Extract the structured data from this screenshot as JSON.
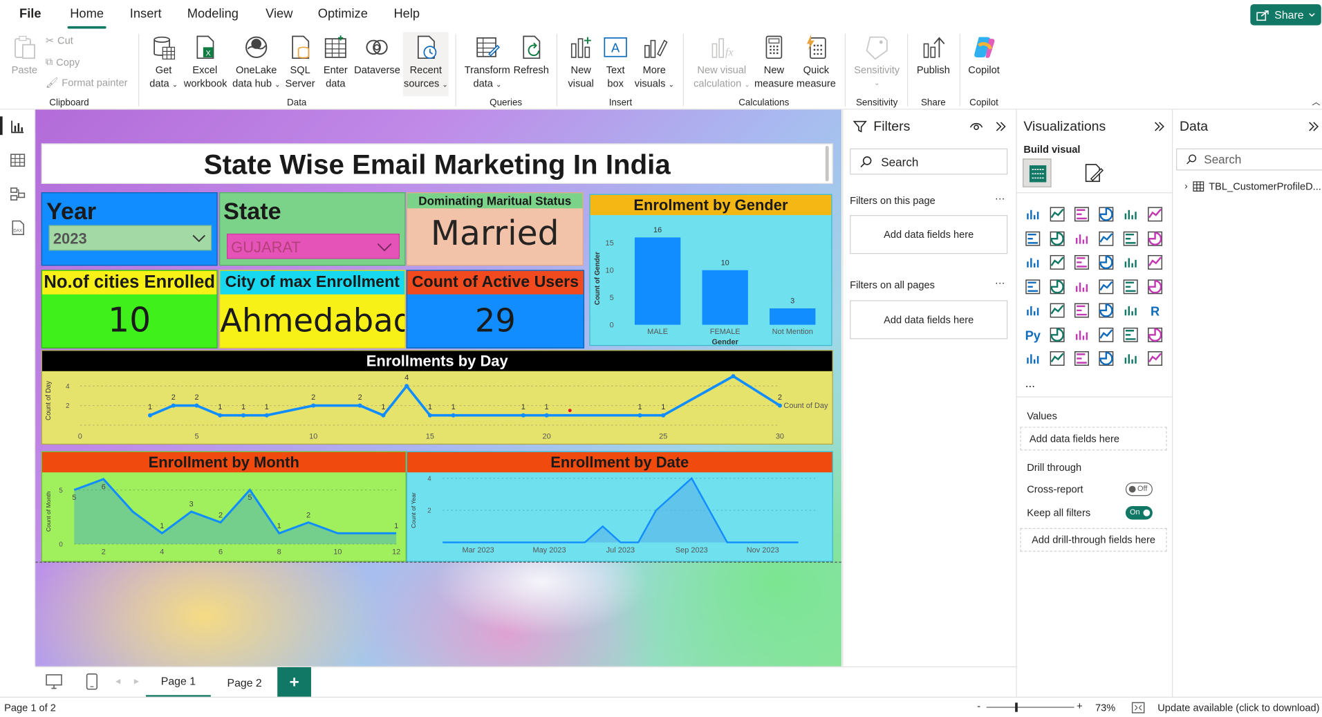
{
  "menu": {
    "items": [
      "File",
      "Home",
      "Insert",
      "Modeling",
      "View",
      "Optimize",
      "Help"
    ],
    "share_label": "Share"
  },
  "ribbon": {
    "clipboard": {
      "paste": "Paste",
      "cut": "Cut",
      "copy": "Copy",
      "format_painter": "Format painter",
      "group": "Clipboard"
    },
    "data": {
      "get_data": [
        "Get",
        "data"
      ],
      "excel": [
        "Excel",
        "workbook"
      ],
      "onelake": [
        "OneLake",
        "data hub"
      ],
      "sql": [
        "SQL",
        "Server"
      ],
      "enter": [
        "Enter",
        "data"
      ],
      "dataverse": [
        "Dataverse"
      ],
      "recent": [
        "Recent",
        "sources"
      ],
      "group": "Data"
    },
    "queries": {
      "transform": [
        "Transform",
        "data"
      ],
      "refresh": [
        "Refresh"
      ],
      "group": "Queries"
    },
    "insert": {
      "new_visual": [
        "New",
        "visual"
      ],
      "text_box": [
        "Text",
        "box"
      ],
      "more_visuals": [
        "More",
        "visuals"
      ],
      "group": "Insert"
    },
    "calculations": {
      "new_visual_calc": [
        "New visual",
        "calculation"
      ],
      "new_measure": [
        "New",
        "measure"
      ],
      "quick_measure": [
        "Quick",
        "measure"
      ],
      "group": "Calculations"
    },
    "sensitivity": {
      "label": "Sensitivity",
      "group": "Sensitivity"
    },
    "share": {
      "publish": "Publish",
      "group": "Share"
    },
    "copilot": {
      "label": "Copilot",
      "group": "Copilot"
    }
  },
  "report": {
    "title": "State Wise Email Marketing In India",
    "year": {
      "label": "Year",
      "value": "2023"
    },
    "state": {
      "label": "State",
      "value": "GUJARAT"
    },
    "marital": {
      "label": "Dominating Maritual Status",
      "value": "Married"
    },
    "cities": {
      "label": "No.of cities Enrolled",
      "value": "10"
    },
    "max_city": {
      "label": "City of max Enrollment",
      "value": "Ahmedabad"
    },
    "active": {
      "label": "Count of Active Users",
      "value": "29"
    },
    "gender_title": "Enrolment by Gender",
    "day_title": "Enrollments by Day",
    "month_title": "Enrollment by Month",
    "date_title": "Enrollment by Date"
  },
  "chart_data": [
    {
      "type": "bar",
      "title": "Enrolment by Gender",
      "xlabel": "Gender",
      "ylabel": "Count of Gender",
      "categories": [
        "MALE",
        "FEMALE",
        "Not Mention"
      ],
      "values": [
        16,
        10,
        3
      ],
      "yticks": [
        0,
        5,
        10,
        15
      ],
      "ylim": [
        0,
        17
      ],
      "color": "#118dff"
    },
    {
      "type": "line",
      "title": "Enrollments by Day",
      "ylabel": "Count of Day",
      "legend": "Count of Day",
      "x": [
        3,
        4,
        5,
        6,
        7,
        8,
        10,
        12,
        13,
        14,
        15,
        16,
        19,
        20,
        24,
        25,
        28,
        30
      ],
      "y": [
        1,
        2,
        2,
        1,
        1,
        1,
        2,
        2,
        1,
        4,
        1,
        1,
        1,
        1,
        1,
        1,
        5,
        2
      ],
      "xticks": [
        0,
        5,
        10,
        15,
        20,
        25,
        30
      ],
      "yticks": [
        2,
        4
      ],
      "xlim": [
        0,
        30
      ],
      "ylim": [
        0,
        5
      ],
      "highlight_point": {
        "x": 21,
        "y": 1.5
      },
      "color": "#118dff"
    },
    {
      "type": "area",
      "title": "Enrollment by Month",
      "ylabel": "Count of Month",
      "x": [
        1,
        2,
        3,
        4,
        5,
        6,
        7,
        8,
        9,
        10,
        11,
        12
      ],
      "y": [
        5,
        6,
        3,
        1,
        3,
        2,
        5,
        1,
        2,
        1,
        1,
        1
      ],
      "point_labels": [
        "5",
        "6",
        "",
        "1",
        "3",
        "2",
        "5",
        "1",
        "2",
        "",
        "",
        "1"
      ],
      "xticks": [
        2,
        4,
        6,
        8,
        10,
        12
      ],
      "yticks": [
        0,
        5
      ],
      "xlim": [
        1,
        12
      ],
      "ylim": [
        0,
        6
      ],
      "color": "#118dff"
    },
    {
      "type": "area",
      "title": "Enrollment by Date",
      "ylabel": "Count of Year",
      "x": [
        "Feb 2023",
        "Mar 2023",
        "Apr 2023",
        "May 2023",
        "Jun 2023",
        "Jun 2023",
        "Jul 2023",
        "Jul 2023",
        "Aug 2023",
        "Aug 2023",
        "Sep 2023",
        "Oct 2023",
        "Nov 2023",
        "Dec 2023"
      ],
      "y": [
        0,
        0,
        0,
        0,
        0,
        1,
        0,
        0,
        2,
        3,
        4,
        0,
        0,
        0
      ],
      "xticks": [
        "Mar 2023",
        "May 2023",
        "Jul 2023",
        "Sep 2023",
        "Nov 2023"
      ],
      "yticks": [
        2,
        4
      ],
      "ylim": [
        0,
        4
      ],
      "color": "#118dff"
    }
  ],
  "filters": {
    "title": "Filters",
    "search_placeholder": "Search",
    "on_this_page": "Filters on this page",
    "on_all_pages": "Filters on all pages",
    "add_fields": "Add data fields here"
  },
  "visualizations": {
    "title": "Visualizations",
    "build_visual": "Build visual",
    "values": "Values",
    "add_values": "Add data fields here",
    "drill_through": "Drill through",
    "cross_report": "Cross-report",
    "cross_report_state": "Off",
    "keep_filters": "Keep all filters",
    "keep_filters_state": "On",
    "add_drill": "Add drill-through fields here",
    "more": "..."
  },
  "data_pane": {
    "title": "Data",
    "search_placeholder": "Search",
    "table": "TBL_CustomerProfileD..."
  },
  "pages": {
    "tabs": [
      "Page 1",
      "Page 2"
    ],
    "active": "Page 1",
    "add": "+"
  },
  "status": {
    "page_info": "Page 1 of 2",
    "zoom": "73%",
    "update": "Update available (click to download)",
    "minus": "-",
    "plus": "+"
  }
}
